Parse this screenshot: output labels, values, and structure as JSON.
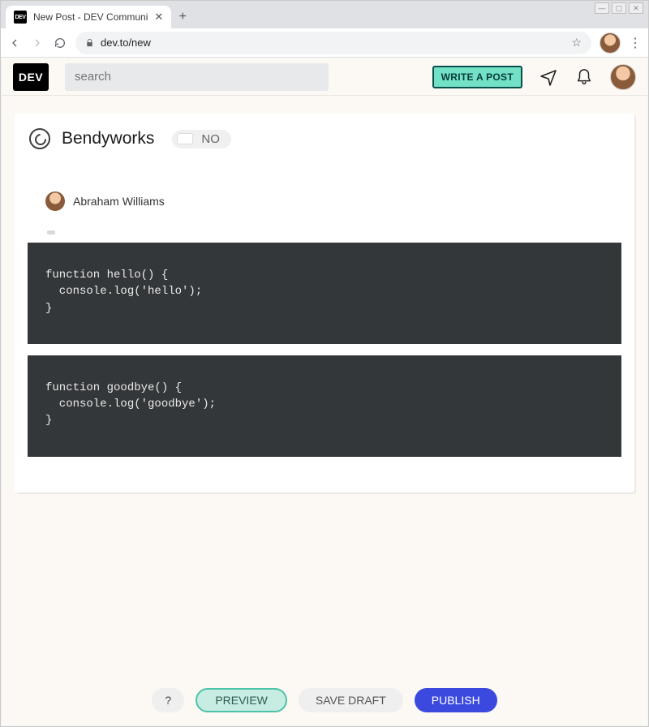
{
  "browser": {
    "tab_title": "New Post - DEV Communi",
    "tab_favicon_text": "DEV",
    "url": "dev.to/new"
  },
  "site_header": {
    "logo_text": "DEV",
    "search_placeholder": "search",
    "write_post_label": "WRITE A POST"
  },
  "editor": {
    "organization": {
      "name": "Bendyworks",
      "toggle_label": "NO"
    },
    "author": {
      "name": "Abraham Williams"
    },
    "code_blocks": [
      "function hello() {\n  console.log('hello');\n}",
      "function goodbye() {\n  console.log('goodbye');\n}"
    ]
  },
  "footer": {
    "help_label": "?",
    "preview_label": "PREVIEW",
    "save_draft_label": "SAVE DRAFT",
    "publish_label": "PUBLISH"
  }
}
